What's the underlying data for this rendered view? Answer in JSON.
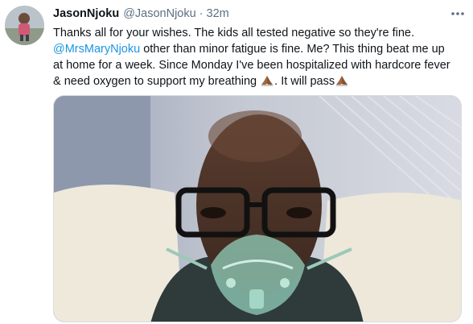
{
  "tweet": {
    "display_name": "JasonNjoku",
    "handle": "@JasonNjoku",
    "separator": "·",
    "timestamp": "32m",
    "text": {
      "line1": "Thanks all for your wishes. The kids all tested negative so they're fine.",
      "mention": "@MrsMaryNjoku",
      "line2_rest": " other than minor fatigue is fine. Me? This thing beat me up",
      "line3": "at home for a week. Since Monday I've been hospitalized with hardcore fever",
      "line4_a": "& need oxygen to support my breathing ",
      "line4_b": ". It will pass"
    }
  },
  "icons": {
    "more": "more-options-icon",
    "emoji": "folded-hands-emoji"
  },
  "colors": {
    "text": "#0f1419",
    "secondary": "#5b7083",
    "link": "#1b95e0"
  }
}
